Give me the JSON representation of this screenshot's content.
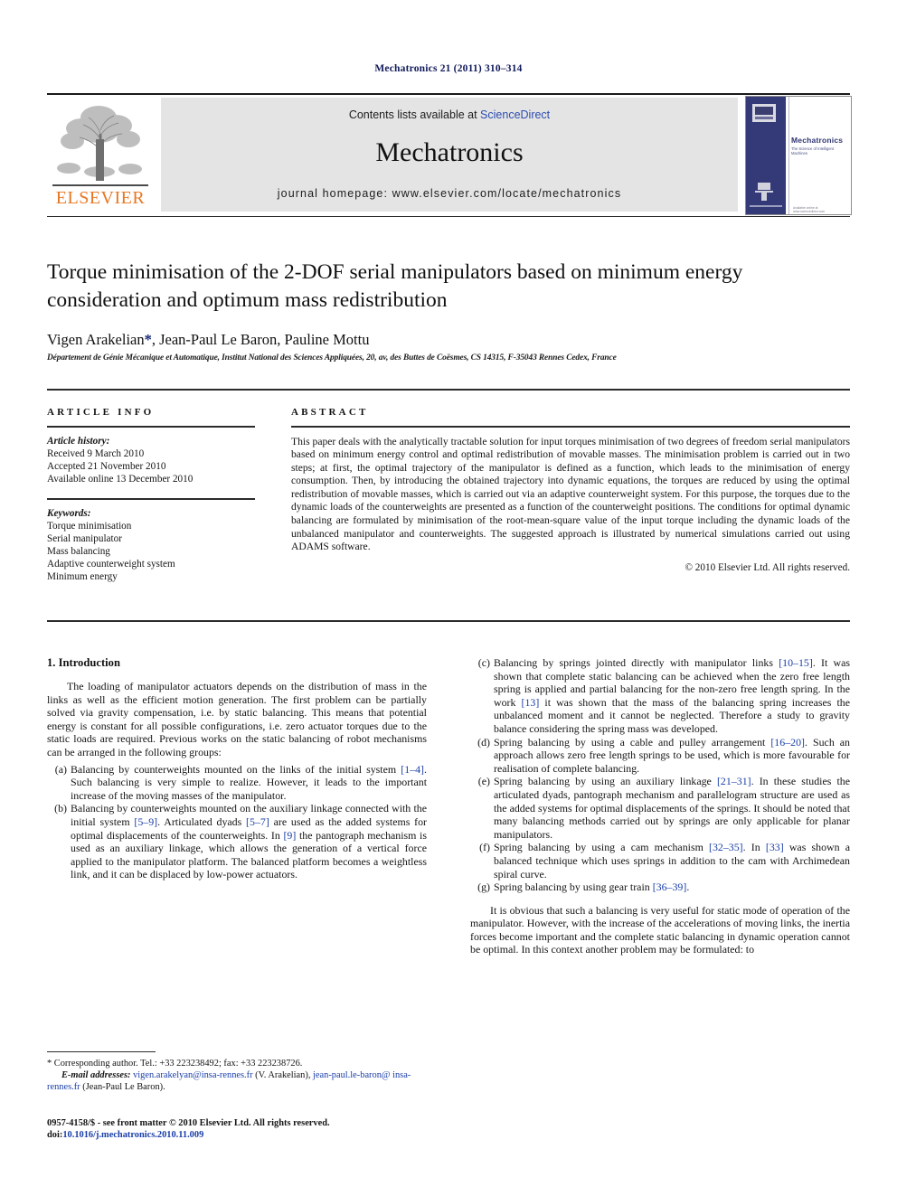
{
  "running_head": "Mechatronics 21 (2011) 310–314",
  "masthead": {
    "contents_prefix": "Contents lists available at ",
    "sciencedirect": "ScienceDirect",
    "journal_title": "Mechatronics",
    "homepage": "journal homepage: www.elsevier.com/locate/mechatronics",
    "publisher_name": "ELSEVIER",
    "cover_title": "Mechatronics",
    "cover_subtitle": "The Science of Intelligent Machines",
    "cover_bottom_note": "Available online at www.sciencedirect.com"
  },
  "article": {
    "title": "Torque minimisation of the 2-DOF serial manipulators based on minimum energy consideration and optimum mass redistribution",
    "authors": "Vigen Arakelian",
    "author_star": "*",
    "authors_rest": ", Jean-Paul Le Baron, Pauline Mottu",
    "affiliation": "Département de Génie Mécanique et Automatique, Institut National des Sciences Appliquées, 20, av, des Buttes de Coësmes, CS 14315, F-35043 Rennes Cedex, France"
  },
  "info": {
    "heading": "ARTICLE INFO",
    "history_label": "Article history:",
    "history": [
      "Received 9 March 2010",
      "Accepted 21 November 2010",
      "Available online 13 December 2010"
    ],
    "keywords_label": "Keywords:",
    "keywords": [
      "Torque minimisation",
      "Serial manipulator",
      "Mass balancing",
      "Adaptive counterweight system",
      "Minimum energy"
    ]
  },
  "abstract": {
    "heading": "ABSTRACT",
    "text": "This paper deals with the analytically tractable solution for input torques minimisation of two degrees of freedom serial manipulators based on minimum energy control and optimal redistribution of movable masses. The minimisation problem is carried out in two steps; at first, the optimal trajectory of the manipulator is defined as a function, which leads to the minimisation of energy consumption. Then, by introducing the obtained trajectory into dynamic equations, the torques are reduced by using the optimal redistribution of movable masses, which is carried out via an adaptive counterweight system. For this purpose, the torques due to the dynamic loads of the counterweights are presented as a function of the counterweight positions. The conditions for optimal dynamic balancing are formulated by minimisation of the root-mean-square value of the input torque including the dynamic loads of the unbalanced manipulator and counterweights. The suggested approach is illustrated by numerical simulations carried out using ADAMS software.",
    "copyright": "© 2010 Elsevier Ltd. All rights reserved."
  },
  "introduction": {
    "heading": "1. Introduction",
    "paragraph": "The loading of manipulator actuators depends on the distribution of mass in the links as well as the efficient motion generation. The first problem can be partially solved via gravity compensation, i.e. by static balancing. This means that potential energy is constant for all possible configurations, i.e. zero actuator torques due to the static loads are required. Previous works on the static balancing of robot mechanisms can be arranged in the following groups:",
    "items": [
      {
        "mark": "(a)",
        "parts": [
          {
            "t": "Balancing by counterweights mounted on the links of the initial system "
          },
          {
            "t": "[1–4]",
            "cite": true
          },
          {
            "t": ". Such balancing is very simple to realize. However, it leads to the important increase of the moving masses of the manipulator."
          }
        ]
      },
      {
        "mark": "(b)",
        "parts": [
          {
            "t": "Balancing by counterweights mounted on the auxiliary linkage connected with the initial system "
          },
          {
            "t": "[5–9]",
            "cite": true
          },
          {
            "t": ". Articulated dyads "
          },
          {
            "t": "[5–7]",
            "cite": true
          },
          {
            "t": " are used as the added systems for optimal displacements of the counterweights. In "
          },
          {
            "t": "[9]",
            "cite": true
          },
          {
            "t": " the pantograph mechanism is used as an auxiliary linkage, which allows the generation of a vertical force applied to the manipulator platform. The balanced platform becomes a weightless link, and it can be displaced by low-power actuators."
          }
        ]
      },
      {
        "mark": "(c)",
        "parts": [
          {
            "t": "Balancing by springs jointed directly with manipulator links "
          },
          {
            "t": "[10–15]",
            "cite": true
          },
          {
            "t": ". It was shown that complete static balancing can be achieved when the zero free length spring is applied and partial balancing for the non-zero free length spring. In the work "
          },
          {
            "t": "[13]",
            "cite": true
          },
          {
            "t": " it was shown that the mass of the balancing spring increases the unbalanced moment and it cannot be neglected. Therefore a study to gravity balance considering the spring mass was developed."
          }
        ]
      },
      {
        "mark": "(d)",
        "parts": [
          {
            "t": "Spring balancing by using a cable and pulley arrangement "
          },
          {
            "t": "[16–20]",
            "cite": true
          },
          {
            "t": ". Such an approach allows zero free length springs to be used, which is more favourable for realisation of complete balancing."
          }
        ]
      },
      {
        "mark": "(e)",
        "parts": [
          {
            "t": "Spring balancing by using an auxiliary linkage "
          },
          {
            "t": "[21–31]",
            "cite": true
          },
          {
            "t": ". In these studies the articulated dyads, pantograph mechanism and parallelogram structure are used as the added systems for optimal displacements of the springs. It should be noted that many balancing methods carried out by springs are only applicable for planar manipulators."
          }
        ]
      },
      {
        "mark": "(f)",
        "parts": [
          {
            "t": "Spring balancing by using a cam mechanism "
          },
          {
            "t": "[32–35]",
            "cite": true
          },
          {
            "t": ". In "
          },
          {
            "t": "[33]",
            "cite": true
          },
          {
            "t": " was shown a balanced technique which uses springs in addition to the cam with Archimedean spiral curve."
          }
        ]
      },
      {
        "mark": "(g)",
        "parts": [
          {
            "t": "Spring balancing by using gear train "
          },
          {
            "t": "[36–39]",
            "cite": true
          },
          {
            "t": "."
          }
        ]
      }
    ],
    "closing_paragraph": "It is obvious that such a balancing is very useful for static mode of operation of the manipulator. However, with the increase of the accelerations of moving links, the inertia forces become important and the complete static balancing in dynamic operation cannot be optimal. In this context another problem may be formulated: to"
  },
  "footnote": {
    "star": "*",
    "corresponding": " Corresponding author. Tel.: +33 223238492; fax: +33 223238726.",
    "email_label": "E-mail addresses:",
    "email1": "vigen.arakelyan@insa-rennes.fr",
    "email1_name": " (V. Arakelian), ",
    "email2": "jean-paul.le-baron@ insa-rennes.fr",
    "email2_name": " (Jean-Paul Le Baron)."
  },
  "publication_footer": {
    "issn_line": "0957-4158/$ - see front matter © 2010 Elsevier Ltd. All rights reserved.",
    "doi_prefix": "doi:",
    "doi": "10.1016/j.mechatronics.2010.11.009"
  }
}
